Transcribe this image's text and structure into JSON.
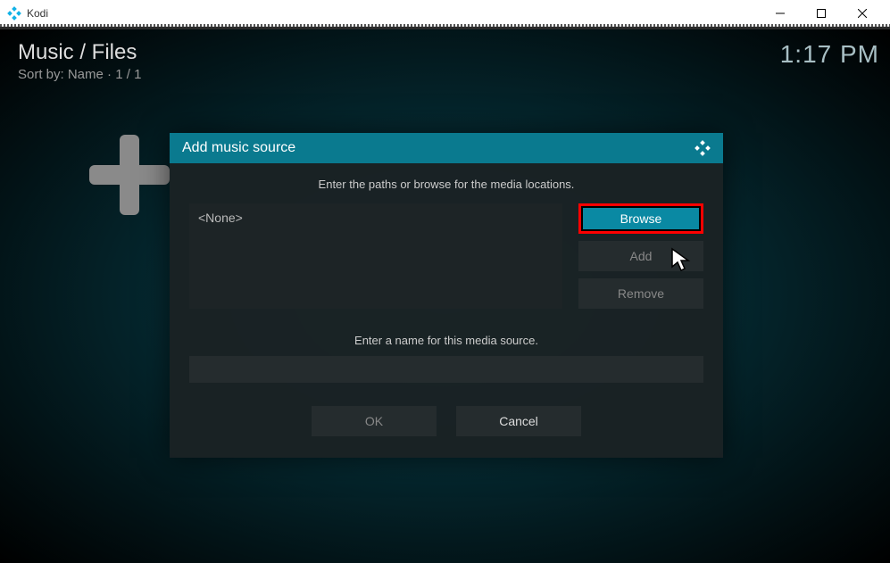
{
  "window": {
    "title": "Kodi"
  },
  "header": {
    "breadcrumb": "Music / Files",
    "sort_label": "Sort by: Name",
    "page_counter": "1 / 1",
    "clock": "1:17 PM"
  },
  "dialog": {
    "title": "Add music source",
    "instruction": "Enter the paths or browse for the media locations.",
    "paths": [
      "<None>"
    ],
    "buttons": {
      "browse": "Browse",
      "add": "Add",
      "remove": "Remove"
    },
    "name_label": "Enter a name for this media source.",
    "name_value": "",
    "ok": "OK",
    "cancel": "Cancel"
  }
}
